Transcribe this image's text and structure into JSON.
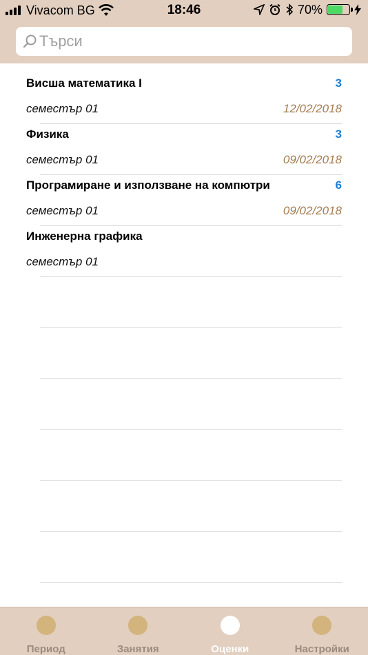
{
  "status_bar": {
    "carrier": "Vivacom BG",
    "time": "18:46",
    "battery_percent": "70%",
    "battery_level": 0.7,
    "icons": [
      "signal-icon",
      "wifi-icon",
      "location-icon",
      "alarm-icon",
      "bluetooth-icon",
      "battery-icon",
      "charging-icon"
    ]
  },
  "search": {
    "placeholder": "Търси",
    "value": ""
  },
  "courses": [
    {
      "name": "Висша математика I",
      "count": "3",
      "semester": "семестър 01",
      "date": "12/02/2018"
    },
    {
      "name": "Физика",
      "count": "3",
      "semester": "семестър 01",
      "date": "09/02/2018"
    },
    {
      "name": "Програмиране и използване на компютри",
      "count": "6",
      "semester": "семестър 01",
      "date": "09/02/2018"
    },
    {
      "name": "Инженерна графика",
      "count": "",
      "semester": "семестър 01",
      "date": ""
    }
  ],
  "tabs": [
    {
      "label": "Период",
      "active": false
    },
    {
      "label": "Занятия",
      "active": false
    },
    {
      "label": "Оценки",
      "active": true
    },
    {
      "label": "Настройки",
      "active": false
    }
  ],
  "colors": {
    "accent_bar": "#e2cfbf",
    "count_blue": "#1a7fd6",
    "date_brown": "#a37c4f",
    "tab_dot": "#d2b47c"
  }
}
